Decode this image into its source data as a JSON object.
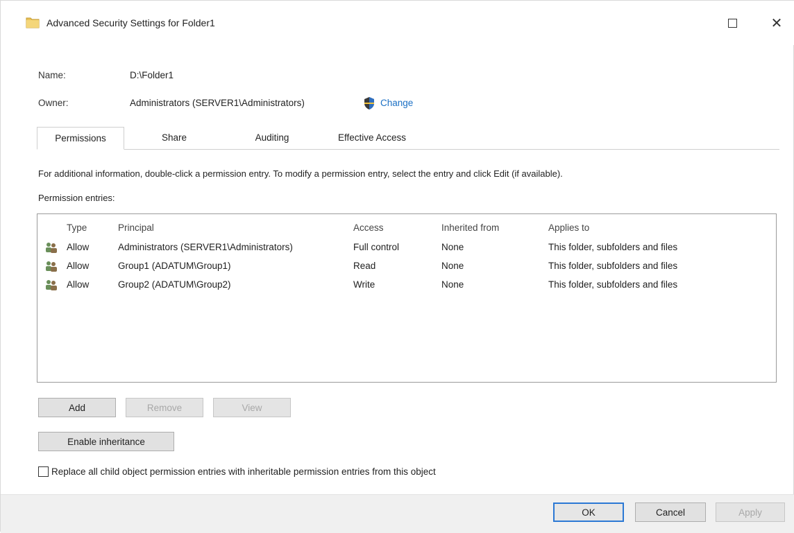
{
  "window": {
    "title": "Advanced Security Settings for Folder1",
    "maximize_icon": "maximize-icon",
    "close_glyph": "✕"
  },
  "fields": {
    "name_label": "Name:",
    "name_value": "D:\\Folder1",
    "owner_label": "Owner:",
    "owner_value": "Administrators (SERVER1\\Administrators)",
    "change_link": "Change"
  },
  "tabs": [
    {
      "label": "Permissions",
      "active": true
    },
    {
      "label": "Share",
      "active": false
    },
    {
      "label": "Auditing",
      "active": false
    },
    {
      "label": "Effective Access",
      "active": false
    }
  ],
  "info_text": "For additional information, double-click a permission entry. To modify a permission entry, select the entry and click Edit (if available).",
  "entries_label": "Permission entries:",
  "columns": {
    "type": "Type",
    "principal": "Principal",
    "access": "Access",
    "inherited_from": "Inherited from",
    "applies_to": "Applies to"
  },
  "entries": [
    {
      "type": "Allow",
      "principal": "Administrators (SERVER1\\Administrators)",
      "access": "Full control",
      "inherited_from": "None",
      "applies_to": "This folder, subfolders and files"
    },
    {
      "type": "Allow",
      "principal": "Group1 (ADATUM\\Group1)",
      "access": "Read",
      "inherited_from": "None",
      "applies_to": "This folder, subfolders and files"
    },
    {
      "type": "Allow",
      "principal": "Group2 (ADATUM\\Group2)",
      "access": "Write",
      "inherited_from": "None",
      "applies_to": "This folder, subfolders and files"
    }
  ],
  "buttons": {
    "add": "Add",
    "remove": "Remove",
    "view": "View",
    "enable_inheritance": "Enable inheritance",
    "ok": "OK",
    "cancel": "Cancel",
    "apply": "Apply"
  },
  "checkbox": {
    "label": "Replace all child object permission entries with inheritable permission entries from this object",
    "checked": false
  },
  "colors": {
    "link": "#1a6fc4",
    "default_button_border": "#2b78d4",
    "disabled_text": "#a8a8a8"
  }
}
